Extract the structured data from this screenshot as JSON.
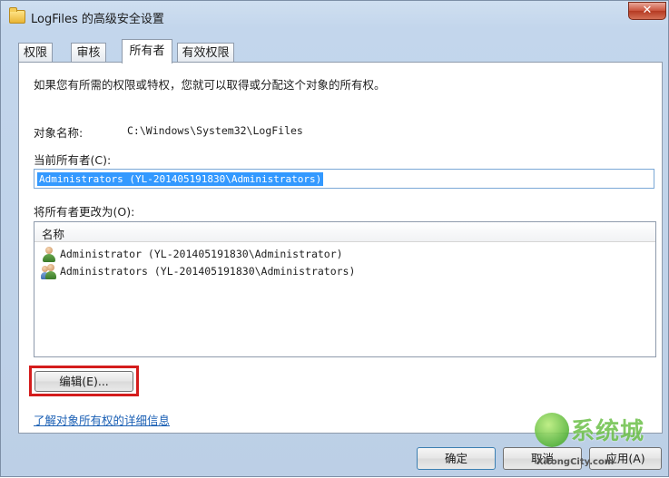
{
  "window": {
    "title": "LogFiles 的高级安全设置",
    "close_glyph": "✕"
  },
  "tabs": [
    {
      "label": "权限",
      "active": false
    },
    {
      "label": "审核",
      "active": false
    },
    {
      "label": "所有者",
      "active": true
    },
    {
      "label": "有效权限",
      "active": false
    }
  ],
  "owner_page": {
    "intro_text": "如果您有所需的权限或特权，您就可以取得或分配这个对象的所有权。",
    "object_name_label": "对象名称:",
    "object_name_value": "C:\\Windows\\System32\\LogFiles",
    "current_owner_label": "当前所有者(C):",
    "current_owner_value": "Administrators (YL-201405191830\\Administrators)",
    "change_owner_label": "将所有者更改为(O):",
    "list_header": "名称",
    "list_items": [
      {
        "icon": "user-icon",
        "name": "Administrator (YL-201405191830\\Administrator)"
      },
      {
        "icon": "group-icon",
        "name": "Administrators (YL-201405191830\\Administrators)"
      }
    ],
    "edit_button_label": "编辑(E)...",
    "learn_more_link": "了解对象所有权的详细信息"
  },
  "footer": {
    "ok_label": "确定",
    "cancel_label": "取消",
    "apply_label": "应用(A)"
  },
  "watermark": {
    "brand": "系统城",
    "url": "XitongCity.com"
  },
  "colors": {
    "selection": "#3399ff",
    "highlight_box": "#d41c1c",
    "link": "#1a5fb4",
    "watermark_green": "#6cc048"
  }
}
